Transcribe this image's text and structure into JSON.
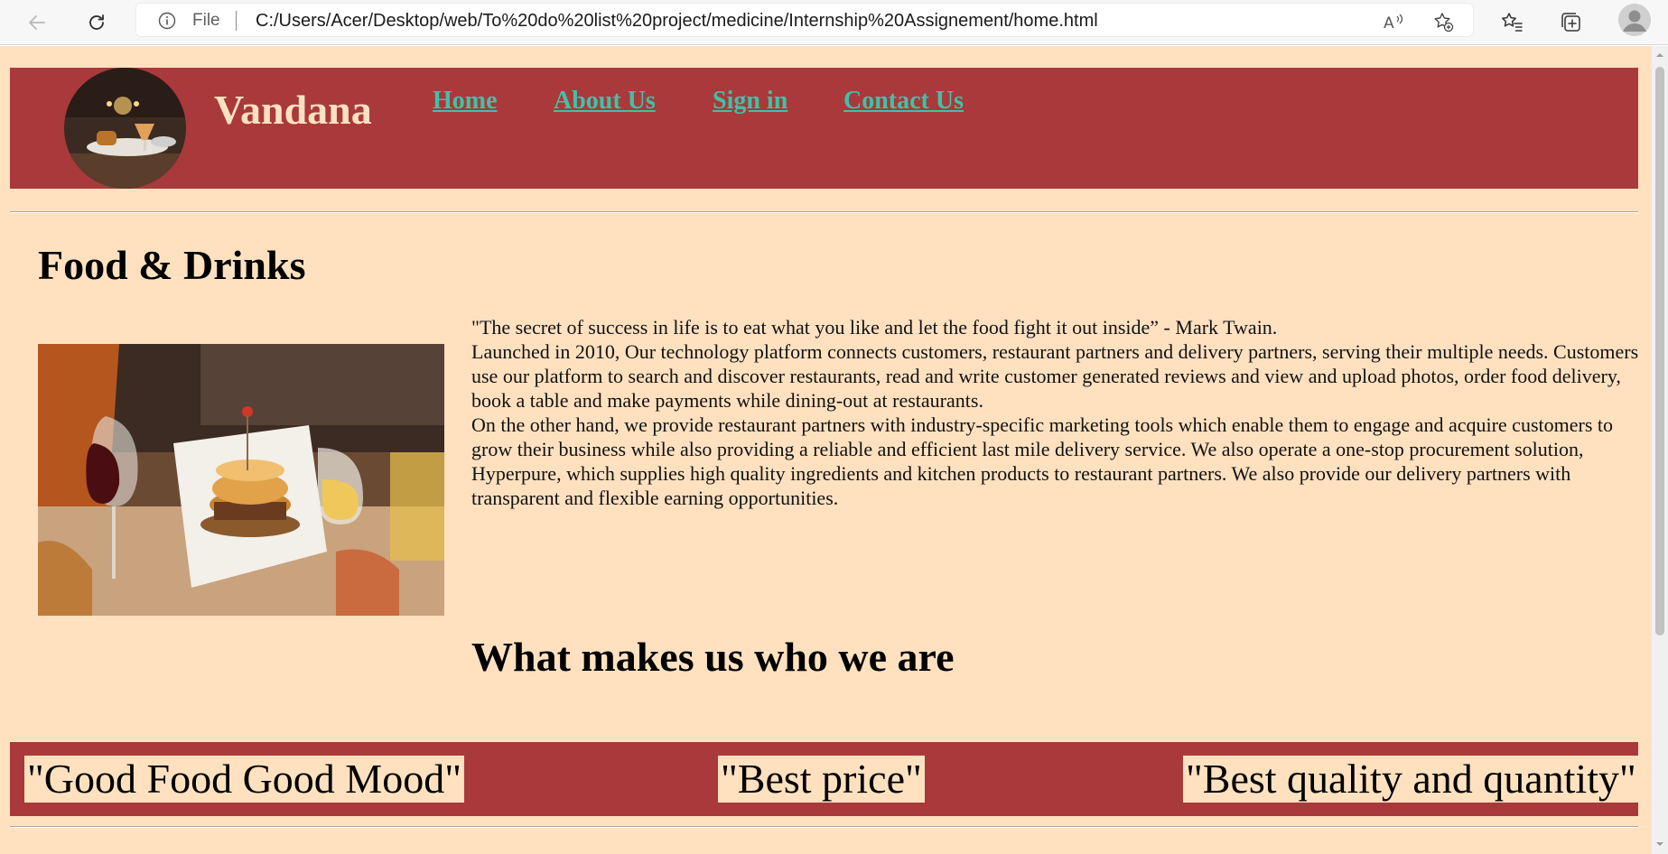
{
  "browser": {
    "scheme": "File",
    "url": "C:/Users/Acer/Desktop/web/To%20do%20list%20project/medicine/Internship%20Assignement/home.html"
  },
  "site": {
    "brand": "Vandana",
    "nav": [
      {
        "label": "Home"
      },
      {
        "label": "About Us"
      },
      {
        "label": "Sign in"
      },
      {
        "label": "Contact Us"
      }
    ]
  },
  "main": {
    "title": "Food & Drinks",
    "quote": "\"The secret of success in life is to eat what you like and let the food fight it out inside” - Mark Twain.",
    "paragraph1": "Launched in 2010, Our technology platform connects customers, restaurant partners and delivery partners, serving their multiple needs. Customers use our platform to search and discover restaurants, read and write customer generated reviews and view and upload photos, order food delivery, book a table and make payments while dining-out at restaurants.",
    "paragraph2": "On the other hand, we provide restaurant partners with industry-specific marketing tools which enable them to engage and acquire customers to grow their business while also providing a reliable and efficient last mile delivery service. We also operate a one-stop procurement solution, Hyperpure, which supplies high quality ingredients and kitchen products to restaurant partners. We also provide our delivery partners with transparent and flexible earning opportunities.",
    "subtitle": "What makes us who we are"
  },
  "taglines": [
    "\"Good Food Good Mood\"",
    "\"Best price\"",
    "\"Best quality and quantity\""
  ],
  "colors": {
    "page_bg": "#ffe1c0",
    "brand_red": "#a9393b",
    "nav_link": "#3fc2a8"
  },
  "icons": {
    "back": "back-arrow-icon",
    "refresh": "refresh-icon",
    "info": "info-icon",
    "read_aloud": "read-aloud-icon",
    "favorite": "add-favorite-icon",
    "favorites": "favorites-icon",
    "collections": "collections-icon",
    "profile": "profile-avatar"
  }
}
